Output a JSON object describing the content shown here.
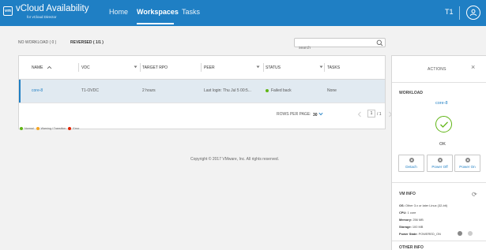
{
  "header": {
    "logo_text": "vm",
    "app_title": "vCloud Availability",
    "app_subtitle": "for vCloud Director",
    "nav": [
      {
        "label": "Home",
        "active": false
      },
      {
        "label": "Workspaces",
        "active": true
      },
      {
        "label": "Tasks",
        "active": false
      }
    ],
    "tenant": "T1",
    "accent_color": "#1f7fc4"
  },
  "filters": [
    {
      "label": "NO WORKLOAD ( 0 )",
      "active": false
    },
    {
      "label": "REVERSED ( 1/1 )",
      "active": true
    }
  ],
  "search": {
    "placeholder": "search"
  },
  "table": {
    "columns": [
      "NAME",
      "VDC",
      "TARGET RPO",
      "PEER",
      "STATUS",
      "TASKS"
    ],
    "rows": [
      {
        "name": "core-8",
        "vdc": "T1-OVDC",
        "rpo": "2 hours",
        "peer": "Last login: Thu Jul 5 00:5...",
        "status": "Failed back",
        "tasks": "None"
      }
    ],
    "rows_per_page_label": "ROWS PER PAGE:",
    "rows_per_page": "30",
    "page": "1",
    "page_total": "/ 1"
  },
  "legend": [
    {
      "label": "Normal",
      "color": "#60b515"
    },
    {
      "label": "Warning / Transition",
      "color": "#f5a623"
    },
    {
      "label": "Error",
      "color": "#e12200"
    }
  ],
  "footer": "Copyright © 2017 VMware, Inc. All rights reserved.",
  "panel": {
    "title": "ACTIONS",
    "workload_title": "WORKLOAD",
    "workload_name": "core-8",
    "state": "OK",
    "actions": [
      "Detach",
      "Power Off",
      "Power On"
    ],
    "vm_info_title": "VM INFO",
    "vm_info": [
      {
        "key": "OS:",
        "value": "Other 3.x or later Linux (32-bit)"
      },
      {
        "key": "CPU:",
        "value": "1 core"
      },
      {
        "key": "Memory:",
        "value": "256 MB"
      },
      {
        "key": "Storage:",
        "value": "100 MB"
      },
      {
        "key": "Power State:",
        "value": "POWERED_ON"
      }
    ],
    "other_info_title": "OTHER INFO"
  }
}
